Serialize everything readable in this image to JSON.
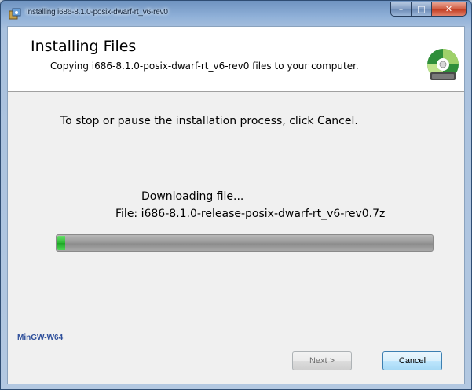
{
  "window": {
    "title": "Installing i686-8.1.0-posix-dwarf-rt_v6-rev0",
    "caption_buttons": {
      "minimize": "–",
      "maximize": "□",
      "close": "✕"
    }
  },
  "header": {
    "title": "Installing Files",
    "subtitle": "Copying i686-8.1.0-posix-dwarf-rt_v6-rev0 files to your computer.",
    "logo_icon": "installer-disc-icon"
  },
  "body": {
    "instruction": "To stop or pause the installation process, click Cancel.",
    "status": "Downloading file...",
    "file_line": "File: i686-8.1.0-release-posix-dwarf-rt_v6-rev0.7z",
    "progress": 0.02
  },
  "footer": {
    "brand": "MinGW-W64",
    "next_label": "Next >",
    "cancel_label": "Cancel"
  },
  "colors": {
    "progress_fill": "#2cb733",
    "brand_text": "#2e4f9b",
    "close_button": "#c13b1f"
  }
}
